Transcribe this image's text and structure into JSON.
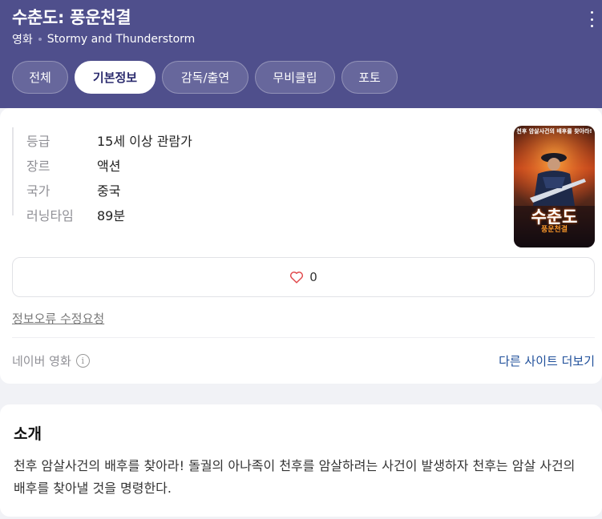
{
  "header": {
    "title": "수춘도: 풍운천결",
    "category": "영화",
    "english_title": "Stormy and Thunderstorm",
    "tabs": [
      "전체",
      "기본정보",
      "감독/출연",
      "무비클립",
      "포토"
    ],
    "active_tab": "기본정보"
  },
  "info": {
    "rows": [
      {
        "key": "등급",
        "value": "15세 이상 관람가"
      },
      {
        "key": "장르",
        "value": "액션"
      },
      {
        "key": "국가",
        "value": "중국"
      },
      {
        "key": "러닝타임",
        "value": "89분"
      }
    ],
    "poster": {
      "top_text": "천후 암살사건의 배후를 찾아라!",
      "title": "수춘도",
      "subtitle": "풍운천결"
    }
  },
  "like": {
    "count": "0",
    "icon": "heart-icon"
  },
  "report_link": "정보오류 수정요청",
  "source_label": "네이버 영화",
  "info_icon": "ⓘ",
  "more_sites": "다른 사이트 더보기",
  "intro": {
    "title": "소개",
    "text": "천후 암살사건의 배후를 찾아라! 돌궐의 아나족이 천후를 암살하려는 사건이 발생하자 천후는 암살 사건의 배후를 찾아낼 것을 명령한다."
  },
  "colors": {
    "header_bg": "#4f4f8c",
    "accent_link": "#1f4f9a",
    "heart": "#e0474a"
  }
}
